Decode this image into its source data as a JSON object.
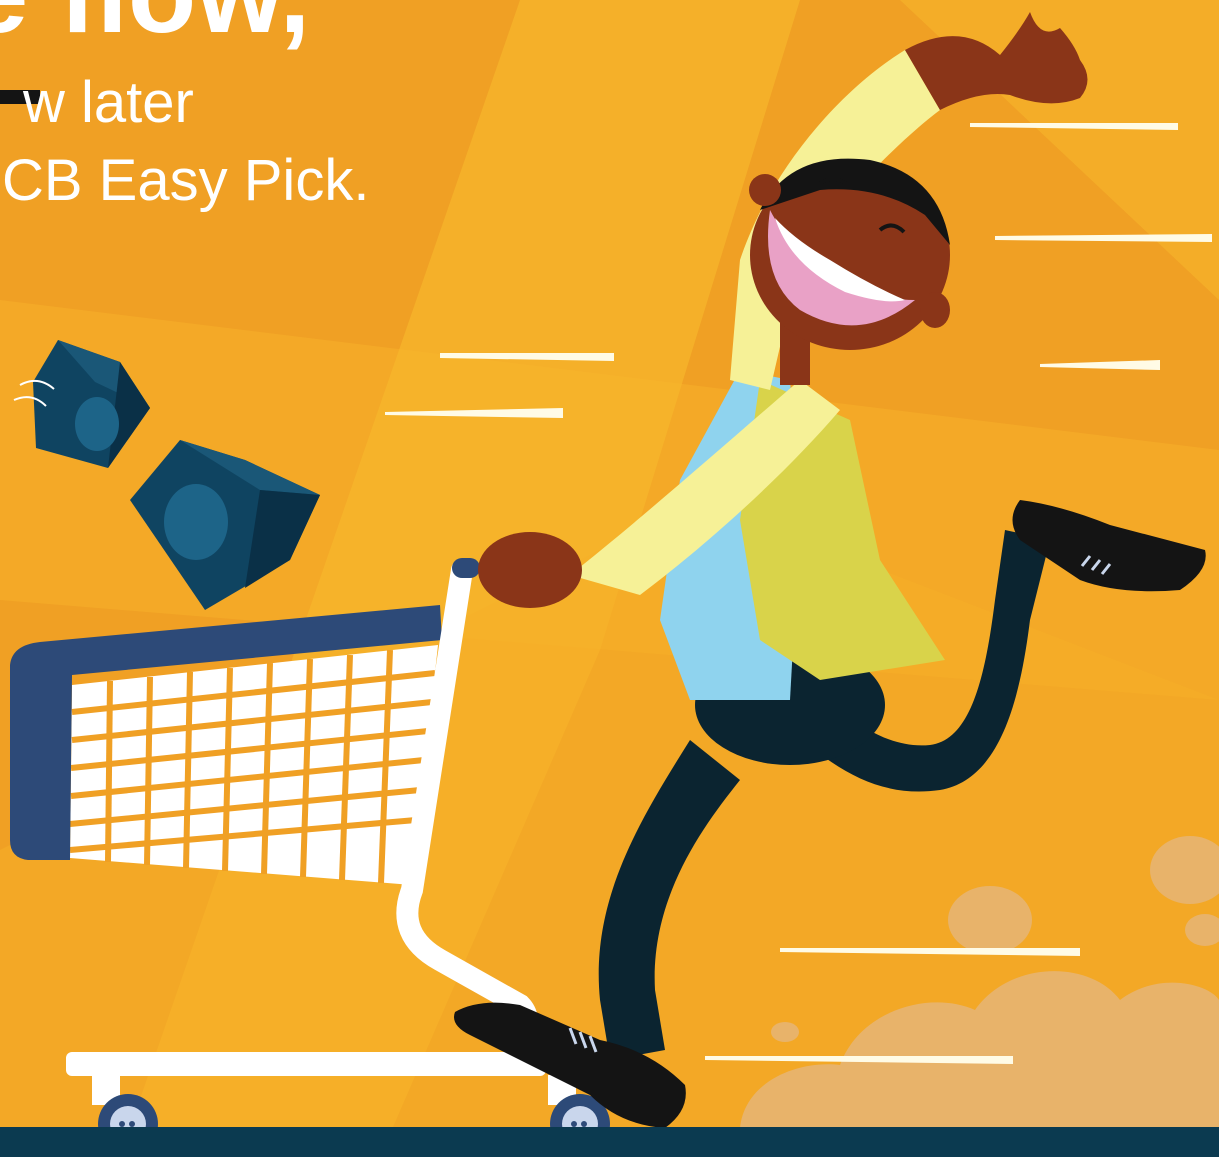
{
  "headline": "e flow,",
  "subline_1": "w later",
  "subline_2": "CB Easy Pick.",
  "colors": {
    "background": "#f0a024",
    "shirt": "#f6f197",
    "vest": "#d9d34a",
    "inner_shirt": "#8fd3ee",
    "trousers": "#0b2430",
    "skin": "#8a3518",
    "cart_frame": "#ffffff",
    "cart_bumper": "#2d4a78",
    "boxes": "#0f4461",
    "ground": "#0b3a50",
    "dust": "#e8b36a"
  },
  "illustration": {
    "subject": "man-running-with-shopping-cart",
    "icons": [
      "shopping-cart-icon",
      "box-icon",
      "speed-line-icon",
      "dust-cloud-icon"
    ]
  }
}
